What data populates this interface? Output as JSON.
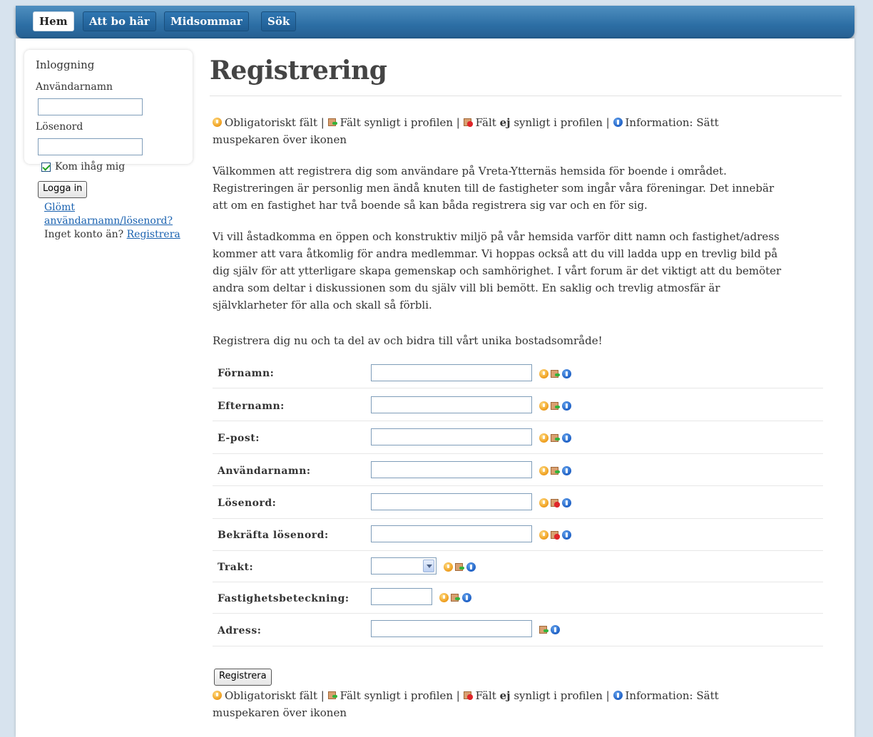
{
  "nav": {
    "items": [
      {
        "label": "Hem",
        "active": true
      },
      {
        "label": "Att bo här",
        "active": false
      },
      {
        "label": "Midsommar",
        "active": false
      },
      {
        "label": "Sök",
        "active": false
      }
    ]
  },
  "login": {
    "title": "Inloggning",
    "username_label": "Användarnamn",
    "username_value": "",
    "password_label": "Lösenord",
    "password_value": "",
    "remember_label": "Kom ihåg mig",
    "remember_checked": true,
    "login_button": "Logga in",
    "forgot_line1": "Glömt",
    "forgot_line2": "användarnamn/lösenord?",
    "no_account_text": "Inget konto än?",
    "register_link": "Registrera"
  },
  "page": {
    "title": "Registrering",
    "legend": {
      "required": "Obligatoriskt fält |",
      "visible": "Fält synligt i profilen |",
      "hidden_pre": "Fält",
      "hidden_bold": "ej",
      "hidden_post": "synligt i profilen |",
      "info": "Information: Sätt muspekaren över ikonen"
    },
    "intro1": "Välkommen att registrera dig som användare på Vreta-Ytternäs hemsida för boende i området. Registreringen är personlig men ändå knuten till de fastigheter som ingår våra föreningar. Det innebär att om en fastighet har två boende så kan båda registrera sig var och en för sig.",
    "intro2": "Vi vill åstadkomma en öppen och konstruktiv miljö på vår hemsida varför ditt namn och fastighet/adress kommer att vara åtkomlig för andra medlemmar. Vi hoppas också att du vill ladda upp en trevlig bild på dig själv för att ytterligare skapa gemenskap och samhörighet. I vårt forum är det viktigt att du bemöter andra som deltar i diskussionen som du själv vill bli bemött. En saklig och trevlig atmosfär är självklarheter för alla och skall så förbli.",
    "intro3": "Registrera dig nu och ta del av och bidra till vårt unika bostadsområde!",
    "submit_button": "Registrera"
  },
  "form": {
    "fields": [
      {
        "label": "Förnamn:",
        "type": "text",
        "value": "",
        "icons": [
          "required-icon",
          "visible-in-profile-icon",
          "info-icon"
        ]
      },
      {
        "label": "Efternamn:",
        "type": "text",
        "value": "",
        "icons": [
          "required-icon",
          "visible-in-profile-icon",
          "info-icon"
        ]
      },
      {
        "label": "E-post:",
        "type": "text",
        "value": "",
        "icons": [
          "required-icon",
          "visible-in-profile-icon",
          "info-icon"
        ]
      },
      {
        "label": "Användarnamn:",
        "type": "text",
        "value": "",
        "icons": [
          "required-icon",
          "visible-in-profile-icon",
          "info-icon"
        ]
      },
      {
        "label": "Lösenord:",
        "type": "password",
        "value": "",
        "icons": [
          "required-icon",
          "not-visible-in-profile-icon",
          "info-icon"
        ]
      },
      {
        "label": "Bekräfta lösenord:",
        "type": "password",
        "value": "",
        "icons": [
          "required-icon",
          "not-visible-in-profile-icon",
          "info-icon"
        ]
      },
      {
        "label": "Trakt:",
        "type": "select",
        "value": "",
        "icons": [
          "required-icon",
          "visible-in-profile-icon",
          "info-icon"
        ]
      },
      {
        "label": "Fastighetsbeteckning:",
        "type": "text-short",
        "value": "",
        "icons": [
          "required-icon",
          "visible-in-profile-icon",
          "info-icon"
        ]
      },
      {
        "label": "Adress:",
        "type": "text",
        "value": "",
        "icons": [
          "visible-in-profile-icon",
          "info-icon"
        ]
      }
    ]
  },
  "colors": {
    "nav_bar": "#2c6ea4",
    "background": "#d7e3ee",
    "link": "#1a62b0",
    "required_icon": "#f0a020",
    "info_icon": "#1d5fc4",
    "hidden_icon": "#e0262a"
  }
}
